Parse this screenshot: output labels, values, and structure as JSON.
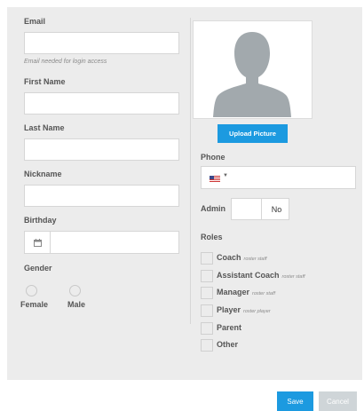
{
  "form": {
    "email_label": "Email",
    "email_value": "",
    "email_hint": "Email needed for login access",
    "first_name_label": "First Name",
    "first_name_value": "",
    "last_name_label": "Last Name",
    "last_name_value": "",
    "nickname_label": "Nickname",
    "nickname_value": "",
    "birthday_label": "Birthday",
    "birthday_value": "",
    "gender_label": "Gender",
    "gender_options": [
      "Female",
      "Male"
    ]
  },
  "profile": {
    "upload_label": "Upload Picture",
    "phone_label": "Phone",
    "phone_value": "",
    "phone_flag_icon": "us-flag-icon",
    "admin_label": "Admin",
    "admin_value": "No",
    "roles_label": "Roles",
    "roles": [
      {
        "name": "Coach",
        "sub": "roster staff"
      },
      {
        "name": "Assistant Coach",
        "sub": "roster staff"
      },
      {
        "name": "Manager",
        "sub": "roster staff"
      },
      {
        "name": "Player",
        "sub": "roster player"
      },
      {
        "name": "Parent",
        "sub": ""
      },
      {
        "name": "Other",
        "sub": ""
      }
    ]
  },
  "footer": {
    "save_label": "Save",
    "cancel_label": "Cancel"
  },
  "colors": {
    "accent": "#1c9ae0",
    "panel_bg": "#ececec",
    "disabled": "#cfd5d8"
  }
}
